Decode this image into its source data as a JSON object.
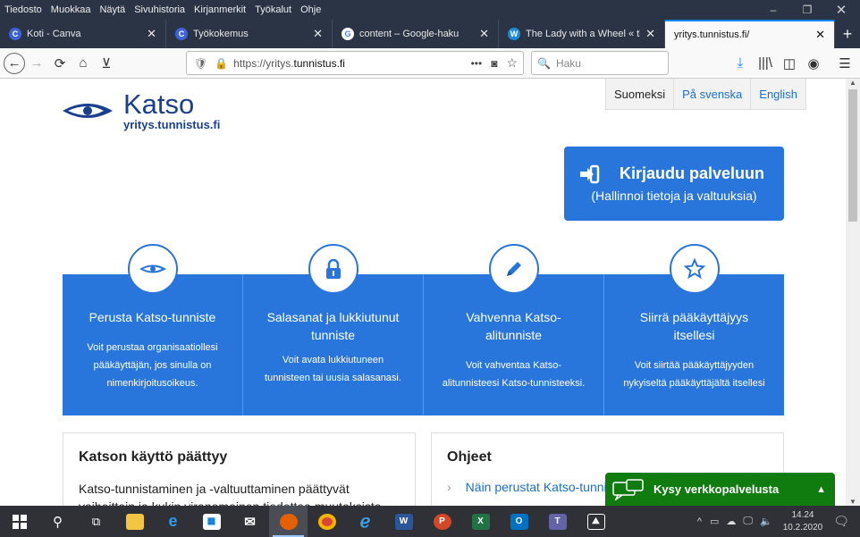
{
  "menu": [
    "Tiedosto",
    "Muokkaa",
    "Näytä",
    "Sivuhistoria",
    "Kirjanmerkit",
    "Työkalut",
    "Ohje"
  ],
  "tabs": [
    {
      "title": "Koti - Canva",
      "fav": "C",
      "color": "#3e62d8"
    },
    {
      "title": "Työkokemus",
      "fav": "C",
      "color": "#3e62d8"
    },
    {
      "title": "content – Google-haku",
      "fav": "G",
      "color": "#ffffff"
    },
    {
      "title": "The Lady with a Wheel « the v",
      "fav": "W",
      "color": "#1d8ad6"
    },
    {
      "title": "yritys.tunnistus.fi/",
      "fav": "",
      "color": ""
    }
  ],
  "url": {
    "prefix": "https://yritys.",
    "domain": "tunnistus.fi"
  },
  "search_placeholder": "Haku",
  "logo": {
    "name": "Katso",
    "sub": "yritys.tunnistus.fi"
  },
  "lang": [
    "Suomeksi",
    "På svenska",
    "English"
  ],
  "login": {
    "title": "Kirjaudu palveluun",
    "sub": "(Hallinnoi tietoja ja valtuuksia)"
  },
  "cards": [
    {
      "title": "Perusta Katso-tunniste",
      "desc": "Voit perustaa organisaatiollesi pääkäyttäjän, jos sinulla on nimenkirjoitusoikeus.",
      "icon": "katso-logo-icon"
    },
    {
      "title": "Salasanat ja lukkiutunut tunniste",
      "desc": "Voit avata lukkiutuneen tunnisteen tai uusia salasanasi.",
      "icon": "lock-icon"
    },
    {
      "title": "Vahvenna Katso-alitunniste",
      "desc": "Voit vahventaa Katso-alitunnisteesi Katso-tunnisteeksi.",
      "icon": "pencil-icon"
    },
    {
      "title": "Siirrä pääkäyttäjyys itsellesi",
      "desc": "Voit siirtää pääkäyttäjyyden nykyiseltä pääkäyttäjältä itsellesi",
      "icon": "star-icon"
    }
  ],
  "box1": {
    "title": "Katson käyttö päättyy",
    "text": "Katso-tunnistaminen ja -valtuuttaminen päättyvät vaiheittain ja kukin viranomainen tiedottaa muutoksista"
  },
  "box2": {
    "title": "Ohjeet",
    "link": "Näin perustat Katso-tunnisteen"
  },
  "chat": "Kysy verkkopalvelusta",
  "clock": {
    "time": "14.24",
    "date": "10.2.2020"
  },
  "colors": {
    "brand": "#2875dc",
    "logo": "#1b3f8f",
    "chat": "#107c10"
  }
}
